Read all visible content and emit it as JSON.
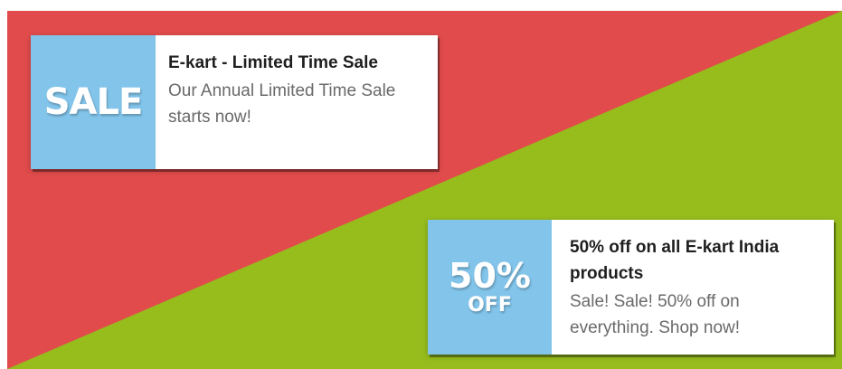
{
  "colors": {
    "red_background": "#e14b4b",
    "green_background": "#96bd1c",
    "badge_background": "#82c4ea",
    "card_background": "#ffffff",
    "title_text": "#1f1f1f",
    "body_text": "#6a6a6a"
  },
  "notifications": [
    {
      "badge_text": "SALE",
      "title": "E-kart - Limited Time Sale",
      "body": "Our Annual Limited Time Sale starts now!"
    },
    {
      "badge_line1": "50%",
      "badge_line2": "OFF",
      "title": "50% off on all E-kart India products",
      "body": "Sale! Sale! 50% off on everything. Shop now!"
    }
  ]
}
